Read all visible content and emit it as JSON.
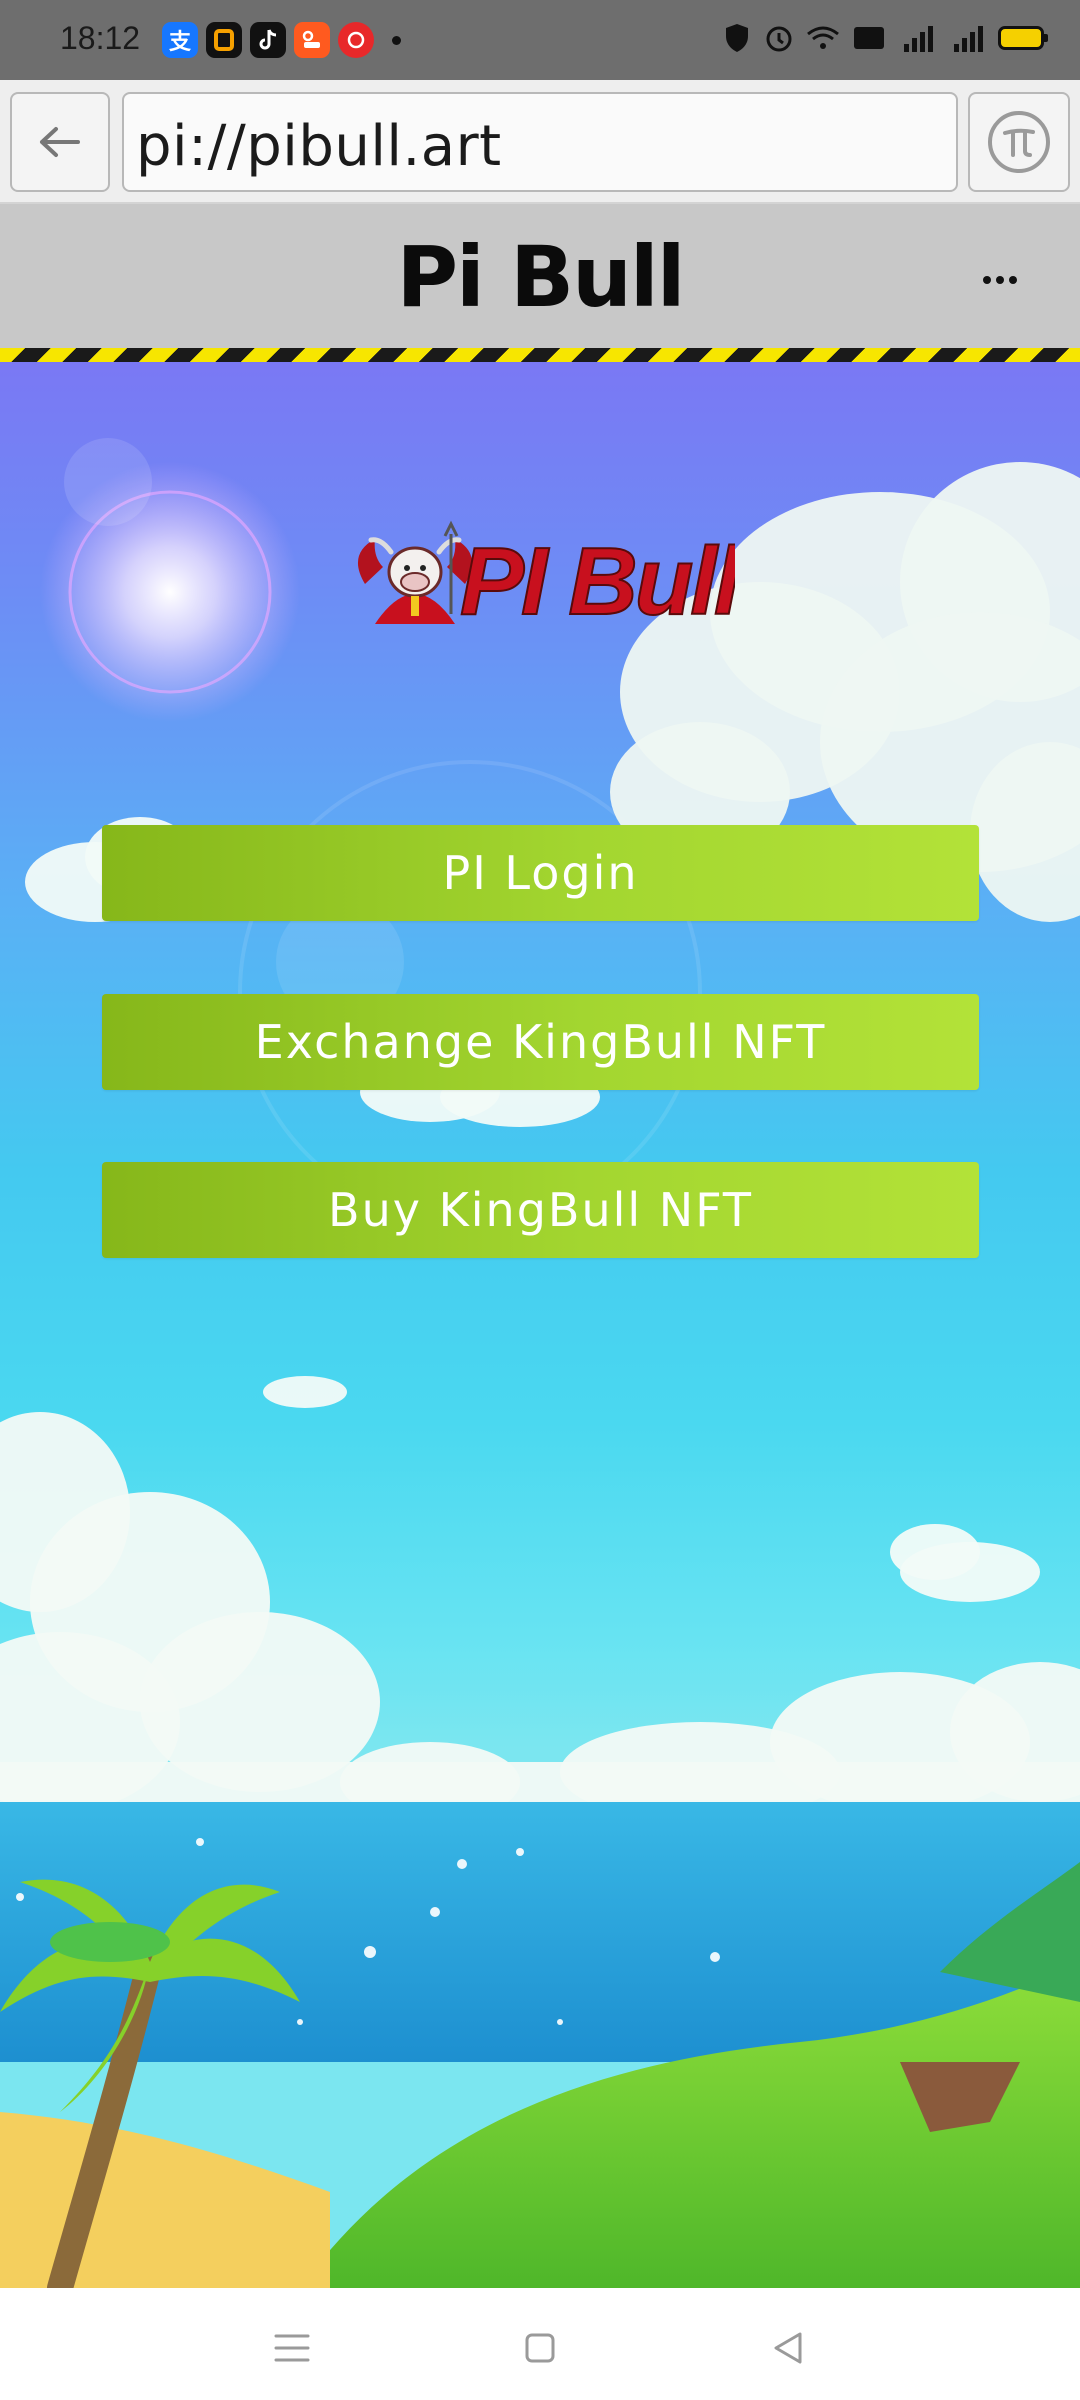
{
  "status_bar": {
    "time": "18:12",
    "notification_icons": [
      "alipay-icon",
      "app-icon",
      "tiktok-icon",
      "app-icon",
      "app-icon"
    ],
    "status_icons": [
      "vpn-icon",
      "alarm-icon",
      "wifi-icon",
      "hd-icon",
      "signal-4g-icon",
      "signal-4g-icon",
      "battery-icon"
    ],
    "vpn_label": "VPN",
    "hd_label": "HD",
    "signal_label": "4G"
  },
  "browser": {
    "url": "pi://pibull.art",
    "back_icon": "back-arrow-icon",
    "pi_icon": "pi-network-icon"
  },
  "header": {
    "title": "Pi Bull",
    "more_icon": "more-horizontal-icon"
  },
  "main": {
    "logo_text": "PI Bull",
    "buttons": [
      {
        "label": "PI Login"
      },
      {
        "label": "Exchange KingBull NFT"
      },
      {
        "label": "Buy KingBull NFT"
      }
    ]
  },
  "nav": {
    "icons": [
      "menu-icon",
      "home-icon",
      "back-icon"
    ]
  },
  "colors": {
    "button": "#a3d630",
    "hazard_yellow": "#f7e600",
    "logo_red": "#c8101e",
    "header_bg": "#c8c8c8"
  }
}
